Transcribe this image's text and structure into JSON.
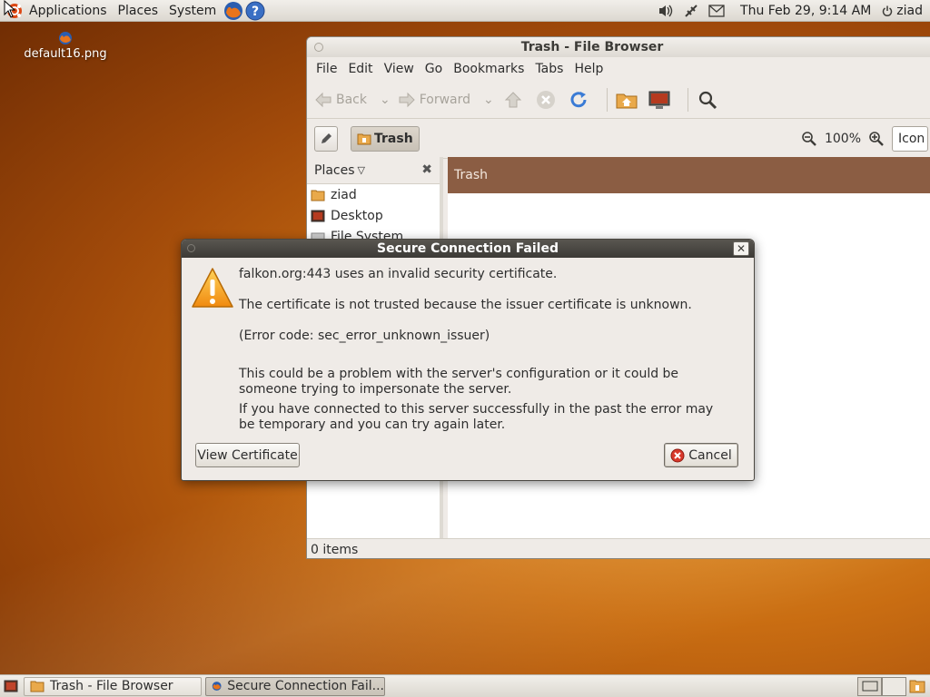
{
  "top_panel": {
    "menus": [
      "Applications",
      "Places",
      "System"
    ],
    "clock": "Thu Feb 29,  9:14 AM",
    "user": "ziad"
  },
  "desktop": {
    "icon_label": "default16.png"
  },
  "file_browser": {
    "title": "Trash - File Browser",
    "menu": [
      "File",
      "Edit",
      "View",
      "Go",
      "Bookmarks",
      "Tabs",
      "Help"
    ],
    "toolbar": {
      "back": "Back",
      "forward": "Forward"
    },
    "location": "Trash",
    "zoom": "100%",
    "view_mode": "Icon View",
    "sidebar": {
      "header": "Places",
      "items": [
        "ziad",
        "Desktop",
        "File System"
      ]
    },
    "banner": "Trash",
    "status": "0 items"
  },
  "dialog": {
    "title": "Secure Connection Failed",
    "line1": "falkon.org:443 uses an invalid security certificate.",
    "line2": "The certificate is not trusted because the issuer certificate is unknown.",
    "line3": "(Error code: sec_error_unknown_issuer)",
    "line4": "This could be a problem with the server's configuration or it could be someone trying to impersonate the server.",
    "line5": "If you have connected to this server successfully in the past the error may be temporary and you can try again later.",
    "view_certificate": "View Certificate",
    "cancel": "Cancel"
  },
  "taskbar": {
    "tasks": [
      "Trash - File Browser",
      "Secure Connection Fail..."
    ]
  },
  "colors": {
    "panel": "#dcd8d0",
    "trash_banner": "#8b5d43",
    "dialog_title": "#3c3a36",
    "warning": "#f0a020"
  }
}
